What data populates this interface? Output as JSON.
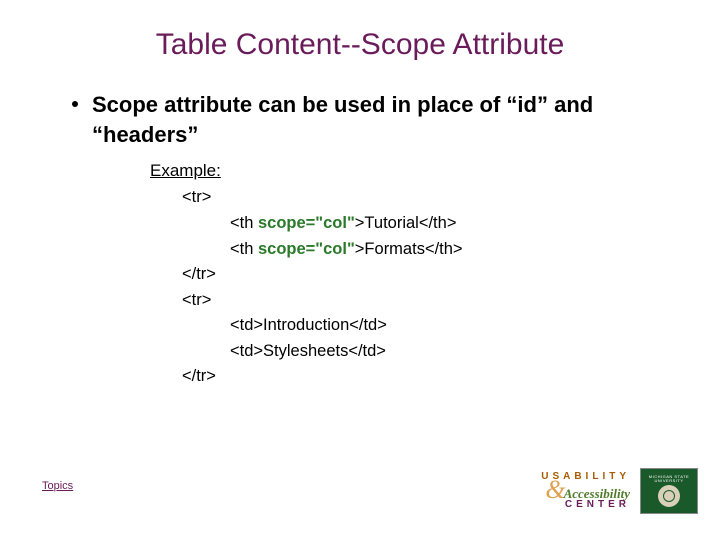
{
  "title": "Table Content--Scope Attribute",
  "bullet": "Scope attribute can be used in place of “id” and “headers”",
  "example_label": "Example:",
  "code": {
    "l1": "<tr>",
    "l2a": "<th ",
    "l2_attr": "scope=\"col\"",
    "l2b": ">Tutorial</th>",
    "l3a": "<th ",
    "l3_attr": "scope=\"col\"",
    "l3b": ">Formats</th>",
    "l4": "</tr>",
    "l5": "<tr>",
    "l6": "<td>Introduction</td>",
    "l7": "<td>Stylesheets</td>",
    "l8": "</tr>"
  },
  "topics_link": "Topics",
  "logo": {
    "usability": "USABILITY",
    "accessibility": "Accessibility",
    "center": "CENTER",
    "msu_line1": "MICHIGAN STATE",
    "msu_line2": "UNIVERSITY"
  }
}
